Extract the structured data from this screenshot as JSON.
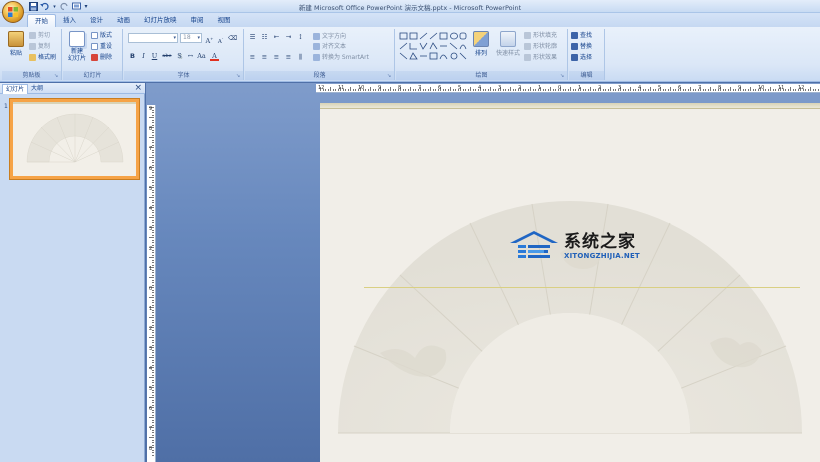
{
  "window": {
    "title": "新建 Microsoft Office PowerPoint 演示文稿.pptx - Microsoft PowerPoint"
  },
  "quick_access": [
    "save-icon",
    "undo-icon",
    "redo-icon",
    "slideshow-icon",
    "customize-icon"
  ],
  "tabs": [
    {
      "label": "开始",
      "active": true
    },
    {
      "label": "插入"
    },
    {
      "label": "设计"
    },
    {
      "label": "动画"
    },
    {
      "label": "幻灯片放映"
    },
    {
      "label": "审阅"
    },
    {
      "label": "视图"
    }
  ],
  "ribbon": {
    "clipboard": {
      "label": "剪贴板",
      "paste": "粘贴",
      "cut": "剪切",
      "copy": "复制",
      "format_painter": "格式刷"
    },
    "slides": {
      "label": "幻灯片",
      "new_slide": "新建\n幻灯片",
      "layout": "版式",
      "reset": "重设",
      "delete": "删除"
    },
    "font": {
      "label": "字体",
      "font_name": "",
      "font_size": "18",
      "bold": "B",
      "italic": "I",
      "underline": "U",
      "strike": "abe",
      "shadow": "S"
    },
    "paragraph": {
      "label": "段落",
      "text_direction": "文字方向",
      "align_text": "对齐文本",
      "convert_smartart": "转换为 SmartArt"
    },
    "drawing": {
      "label": "绘图",
      "arrange": "排列",
      "quick_styles": "快速样式",
      "shape_fill": "形状填充",
      "shape_outline": "形状轮廓",
      "shape_effects": "形状效果"
    },
    "editing": {
      "label": "编辑",
      "find": "查找",
      "replace": "替换",
      "select": "选择"
    }
  },
  "panel": {
    "tabs": [
      "幻灯片",
      "大纲"
    ],
    "slide_number": "1"
  },
  "watermark": {
    "name": "系统之家",
    "url": "XITONGZHIJIA.NET"
  },
  "colors": {
    "office_orange": "#f6a346",
    "ribbon_text": "#15428b",
    "watermark_blue": "#2060b8"
  }
}
